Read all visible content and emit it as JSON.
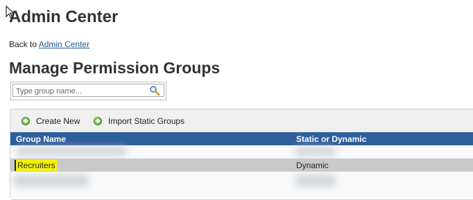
{
  "header": {
    "title": "Admin Center",
    "back_prefix": "Back to",
    "back_link": "Admin Center"
  },
  "page": {
    "title": "Manage Permission Groups"
  },
  "search": {
    "placeholder": "Type group name..."
  },
  "toolbar": {
    "create_label": "Create New",
    "import_label": "Import Static Groups"
  },
  "table": {
    "columns": [
      "Group Name",
      "Static or Dynamic"
    ],
    "rows": [
      {
        "name": "",
        "type": ""
      },
      {
        "name": "Recruiters",
        "type": "Dynamic"
      },
      {
        "name": "",
        "type": ""
      }
    ]
  },
  "colors": {
    "header_bg": "#2e5f9d",
    "link": "#1a5a96",
    "highlight": "#f4f400",
    "selected_row": "#c9c9c9"
  }
}
